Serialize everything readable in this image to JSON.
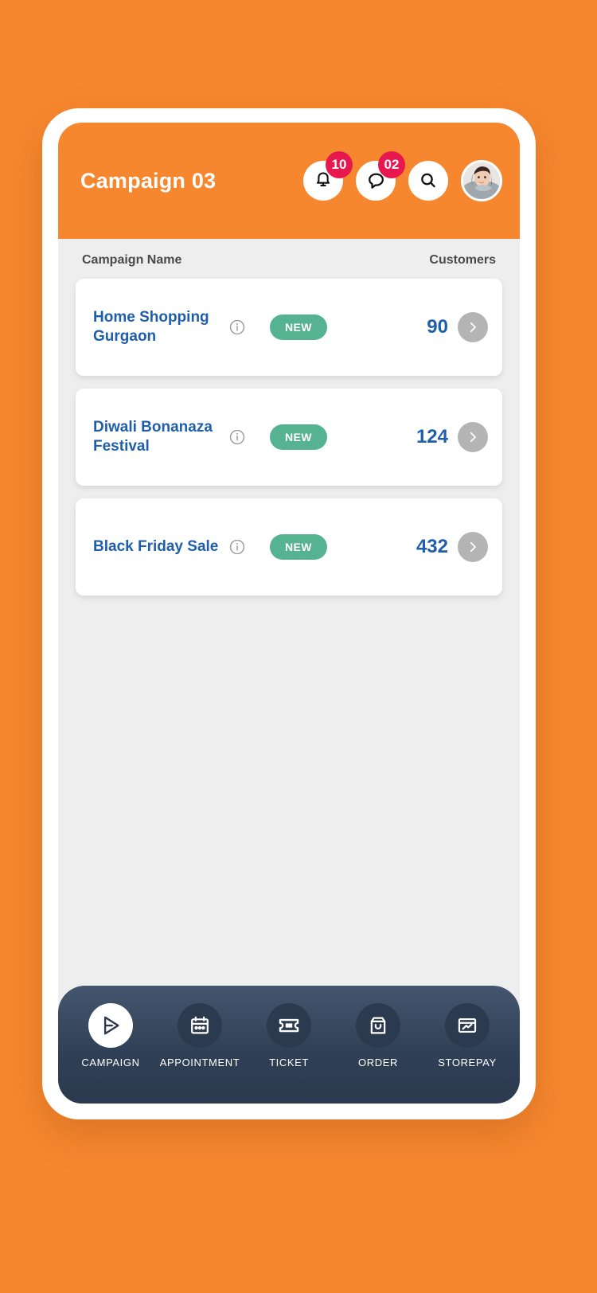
{
  "theme": {
    "background": "#f7872e",
    "header_bg": "#f7872e",
    "accent_blue": "#1f5fa9",
    "badge_red": "#e8174f",
    "new_green": "#55b391",
    "nav_bg": "#2b3a4f",
    "chevron_grey": "#b4b4b4"
  },
  "header": {
    "title": "Campaign 03",
    "notifications": {
      "icon": "bell-icon",
      "badge": "10"
    },
    "messages": {
      "icon": "chat-bubble-icon",
      "badge": "02"
    },
    "search": {
      "icon": "search-icon"
    },
    "avatar": {
      "icon": "user-avatar"
    }
  },
  "list": {
    "columns": {
      "name": "Campaign  Name",
      "customers": "Customers"
    },
    "rows": [
      {
        "name": "Home Shopping Gurgaon",
        "info_icon": "info-icon",
        "status": "NEW",
        "customers": "90",
        "chevron": "chevron-right-icon"
      },
      {
        "name": "Diwali Bonanaza Festival",
        "info_icon": "info-icon",
        "status": "NEW",
        "customers": "124",
        "chevron": "chevron-right-icon"
      },
      {
        "name": "Black Friday Sale",
        "info_icon": "info-icon",
        "status": "NEW",
        "customers": "432",
        "chevron": "chevron-right-icon"
      }
    ]
  },
  "bottom_nav": {
    "items": [
      {
        "label": "CAMPAIGN",
        "icon": "send-play-icon",
        "active": true
      },
      {
        "label": "APPOINTMENT",
        "icon": "calendar-icon",
        "active": false
      },
      {
        "label": "TICKET",
        "icon": "ticket-icon",
        "active": false
      },
      {
        "label": "ORDER",
        "icon": "shopping-bag-icon",
        "active": false
      },
      {
        "label": "STOREPAY",
        "icon": "card-terminal-icon",
        "active": false
      }
    ]
  }
}
